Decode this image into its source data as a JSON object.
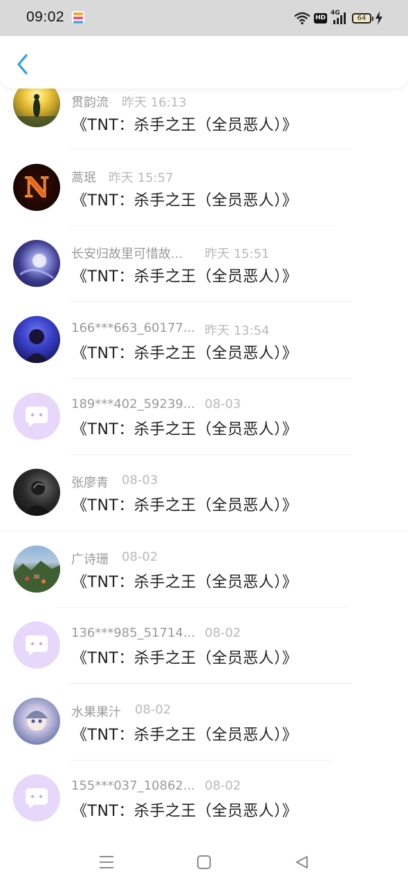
{
  "status_bar": {
    "time": "09:02",
    "network": "4G",
    "hd": "HD",
    "battery": "64"
  },
  "header": {
    "back_icon": "chevron-left-icon",
    "accent_color": "#2f9bea"
  },
  "messages": [
    {
      "name": "贯韵流",
      "time": "昨天 16:13",
      "text": "《TNT：杀手之王（全员恶人）》",
      "avatar": "sunset-girl"
    },
    {
      "name": "蒿珉",
      "time": "昨天 15:57",
      "text": "《TNT：杀手之王（全员恶人）》",
      "avatar": "fire-letter-n"
    },
    {
      "name": "长安归故里可惜故...",
      "time": "昨天 15:51",
      "text": "《TNT：杀手之王（全员恶人）》",
      "avatar": "anime-dark"
    },
    {
      "name": "166***663_60177...",
      "time": "昨天 13:54",
      "text": "《TNT：杀手之王（全员恶人）》",
      "avatar": "purple-night"
    },
    {
      "name": "189***402_59239...",
      "time": "08-03",
      "text": "《TNT：杀手之王（全员恶人）》",
      "avatar": "default-chat"
    },
    {
      "name": "张廖青",
      "time": "08-03",
      "text": "《TNT：杀手之王（全员恶人）》",
      "avatar": "dark-portrait"
    },
    {
      "name": "广诗珊",
      "time": "08-02",
      "text": "《TNT：杀手之王（全员恶人）》",
      "avatar": "landscape"
    },
    {
      "name": "136***985_51714...",
      "time": "08-02",
      "text": "《TNT：杀手之王（全员恶人）》",
      "avatar": "default-chat"
    },
    {
      "name": "水果果汁",
      "time": "08-02",
      "text": "《TNT：杀手之王（全员恶人）》",
      "avatar": "anime-girl"
    },
    {
      "name": "155***037_10862...",
      "time": "08-02",
      "text": "《TNT：杀手之王（全员恶人）》",
      "avatar": "default-chat"
    }
  ],
  "bottom_nav": {
    "menu_icon": "menu-icon",
    "home_icon": "home-square-icon",
    "back_icon": "back-triangle-icon"
  }
}
